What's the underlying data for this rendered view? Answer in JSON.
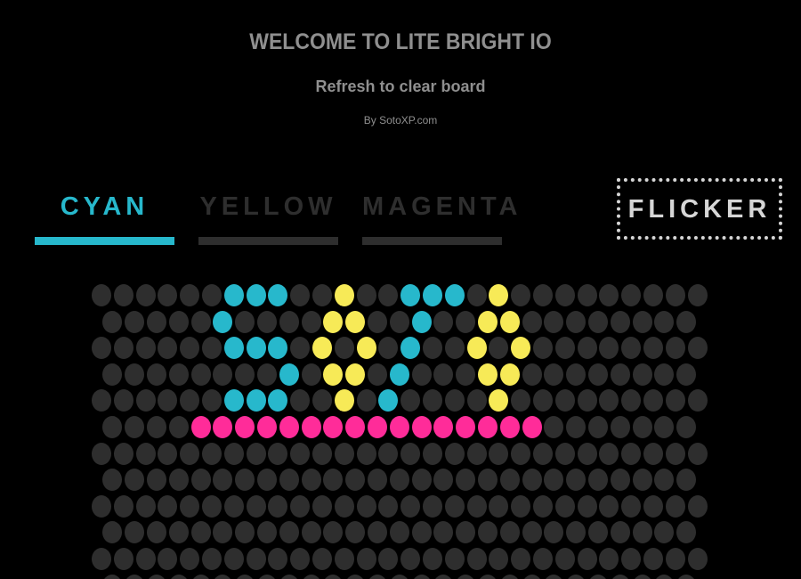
{
  "header": {
    "title": "WELCOME TO LITE BRIGHT IO",
    "subtitle": "Refresh to clear board",
    "byline": "By SotoXP.com"
  },
  "tabs": [
    {
      "label": "CYAN",
      "active": true,
      "color": "#27b8cc"
    },
    {
      "label": "YELLOW",
      "active": false,
      "color": "#f7ea57"
    },
    {
      "label": "MAGENTA",
      "active": false,
      "color": "#ff2c99"
    }
  ],
  "flicker_button": {
    "label": "FLICKER"
  },
  "colors": {
    "background": "#000000",
    "peg_off": "#2e2e2e",
    "cyan": "#27b8cc",
    "yellow": "#f7ea57",
    "magenta": "#ff2c99",
    "inactive_tab": "#2e2e2e",
    "flicker_border": "#d6d6d6"
  },
  "board": {
    "rows": [
      {
        "pegs": 28,
        "lit": {
          "6": "cyan",
          "7": "cyan",
          "8": "cyan",
          "11": "yellow",
          "14": "cyan",
          "15": "cyan",
          "16": "cyan",
          "18": "yellow"
        }
      },
      {
        "pegs": 27,
        "lit": {
          "5": "cyan",
          "10": "yellow",
          "11": "yellow",
          "14": "cyan",
          "17": "yellow",
          "18": "yellow"
        }
      },
      {
        "pegs": 28,
        "lit": {
          "6": "cyan",
          "7": "cyan",
          "8": "cyan",
          "10": "yellow",
          "12": "yellow",
          "14": "cyan",
          "17": "yellow",
          "19": "yellow"
        }
      },
      {
        "pegs": 27,
        "lit": {
          "8": "cyan",
          "10": "yellow",
          "11": "yellow",
          "13": "cyan",
          "17": "yellow",
          "18": "yellow"
        }
      },
      {
        "pegs": 28,
        "lit": {
          "6": "cyan",
          "7": "cyan",
          "8": "cyan",
          "11": "yellow",
          "13": "cyan",
          "18": "yellow"
        }
      },
      {
        "pegs": 27,
        "lit": {
          "4": "magenta",
          "5": "magenta",
          "6": "magenta",
          "7": "magenta",
          "8": "magenta",
          "9": "magenta",
          "10": "magenta",
          "11": "magenta",
          "12": "magenta",
          "13": "magenta",
          "14": "magenta",
          "15": "magenta",
          "16": "magenta",
          "17": "magenta",
          "18": "magenta",
          "19": "magenta"
        }
      },
      {
        "pegs": 28,
        "lit": {}
      },
      {
        "pegs": 27,
        "lit": {}
      },
      {
        "pegs": 28,
        "lit": {}
      },
      {
        "pegs": 27,
        "lit": {}
      },
      {
        "pegs": 28,
        "lit": {}
      },
      {
        "pegs": 27,
        "lit": {}
      }
    ]
  }
}
